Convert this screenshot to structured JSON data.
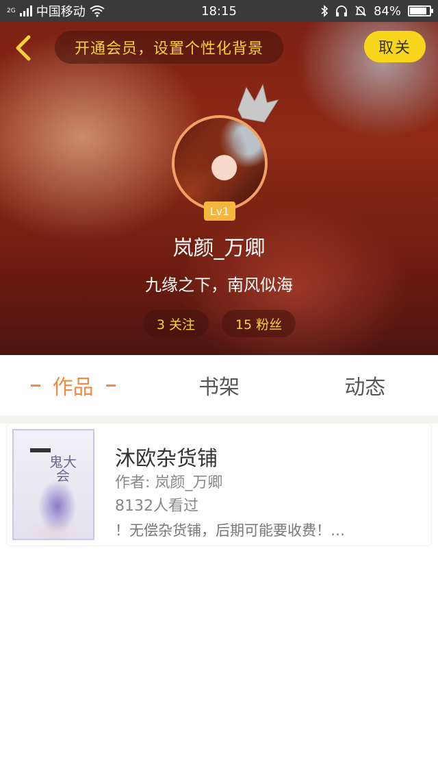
{
  "status_bar": {
    "network": "2G",
    "carrier": "中国移动",
    "time": "18:15",
    "battery_percent": "84%",
    "battery_level": 0.84
  },
  "header": {
    "vip_banner": "开通会员，设置个性化背景",
    "unfollow_label": "取关",
    "accent_color": "#f7d61c"
  },
  "profile": {
    "level": "Lv1",
    "username": "岚颜_万卿",
    "bio": "九缘之下，南风似海",
    "following": "3 关注",
    "fans": "15 粉丝"
  },
  "tabs": [
    {
      "label": "作品",
      "active": true
    },
    {
      "label": "书架",
      "active": false
    },
    {
      "label": "动态",
      "active": false
    }
  ],
  "books": [
    {
      "title": "沐欧杂货铺",
      "author": "作者: 岚颜_万卿",
      "views": "8132人看过",
      "description": "！无偿杂货铺，后期可能要收费！…",
      "cover_text": "鬼大会"
    }
  ]
}
